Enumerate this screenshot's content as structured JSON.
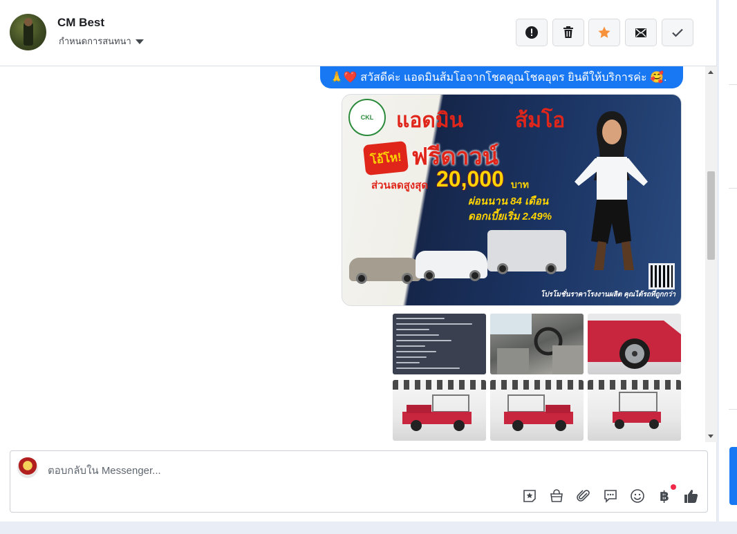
{
  "conversation": {
    "contact_name": "CM Best",
    "subtitle": "กำหนดการสนทนา"
  },
  "header_actions": [
    {
      "name": "mark-spam",
      "icon": "alert-circle-icon"
    },
    {
      "name": "delete",
      "icon": "trash-icon"
    },
    {
      "name": "star",
      "icon": "star-icon"
    },
    {
      "name": "mark-unread",
      "icon": "envelope-icon"
    },
    {
      "name": "mark-done",
      "icon": "check-icon"
    }
  ],
  "messages": {
    "greeting": "🙏❤️ สวัสดีค่ะ แอดมินส้มโอจากโชคคูณโชคอุดร ยินดีให้บริการค่ะ 🥰.",
    "promo": {
      "headline_left": "แอดมิน",
      "headline_right": "ส้มโอ",
      "burst": "โอ้โห!",
      "offer": "ฟรีดาวน์",
      "discount_label": "ส่วนลดสูงสุด",
      "discount_amount": "20,000",
      "discount_unit": "บาท",
      "installment": "ผ่อนนาน 84 เดือน",
      "interest": "ดอกเบี้ยเริ่ม 2.49%",
      "footer": "โปรโมชั่นราคาโรงงานผลิต คุณได้รถที่ถูกกว่า"
    }
  },
  "composer": {
    "placeholder": "ตอบกลับใน Messenger...",
    "tools": [
      "sticker-icon",
      "shopping-bag-icon",
      "attachment-icon",
      "saved-reply-icon",
      "emoji-icon",
      "baht-icon",
      "like-icon"
    ]
  },
  "colors": {
    "accent": "#1877f2",
    "star": "#f7923b",
    "notification_dot": "#f02849"
  }
}
